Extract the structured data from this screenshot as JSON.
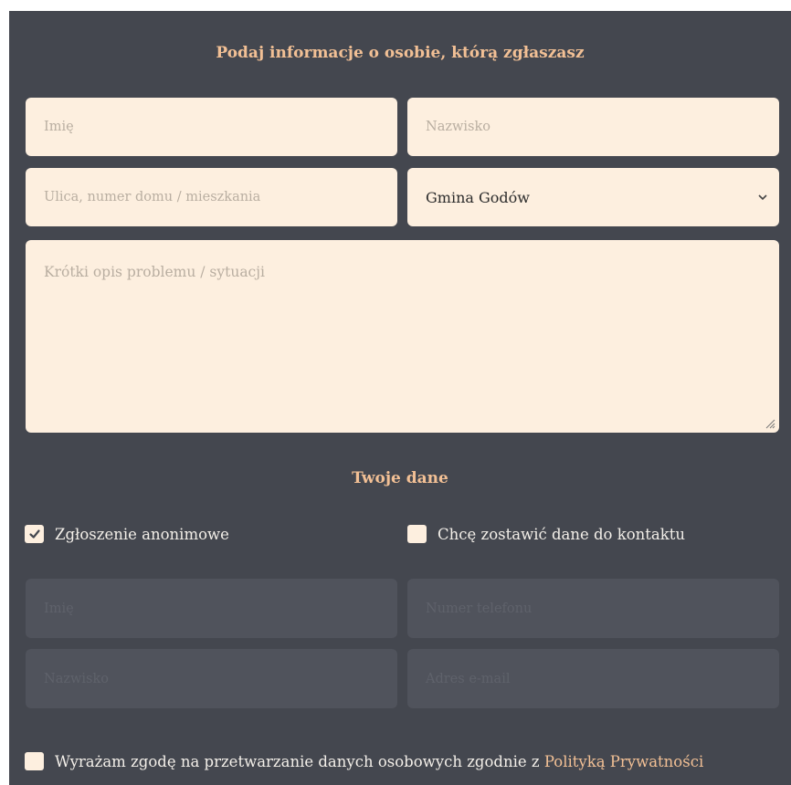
{
  "form": {
    "heading": "Podaj informacje o osobie, którą zgłaszasz",
    "first_name_placeholder": "Imię",
    "last_name_placeholder": "Nazwisko",
    "address_placeholder": "Ulica, numer domu / mieszkania",
    "municipality_selected": "Gmina Godów",
    "description_placeholder": "Krótki opis problemu / sytuacji"
  },
  "contact": {
    "heading": "Twoje dane",
    "anonymous_label": "Zgłoszenie anonimowe",
    "anonymous_checked": true,
    "leave_contact_label": "Chcę zostawić dane do kontaktu",
    "leave_contact_checked": false,
    "first_name_placeholder": "Imię",
    "phone_placeholder": "Numer telefonu",
    "last_name_placeholder": "Nazwisko",
    "email_placeholder": "Adres e-mail"
  },
  "consent": {
    "text": "Wyrażam zgodę na przetwarzanie danych osobowych zgodnie z",
    "link_text": "Polityką Prywatności",
    "checked": false
  },
  "colors": {
    "panel_bg": "#44474f",
    "accent": "#f2c095",
    "field_bg": "#fdefdf",
    "disabled_field_bg": "#50535c"
  },
  "icons": {
    "select_arrow": "chevron-down-icon",
    "checkbox_checked": "check-icon",
    "textarea_resize": "resize-handle-icon"
  }
}
